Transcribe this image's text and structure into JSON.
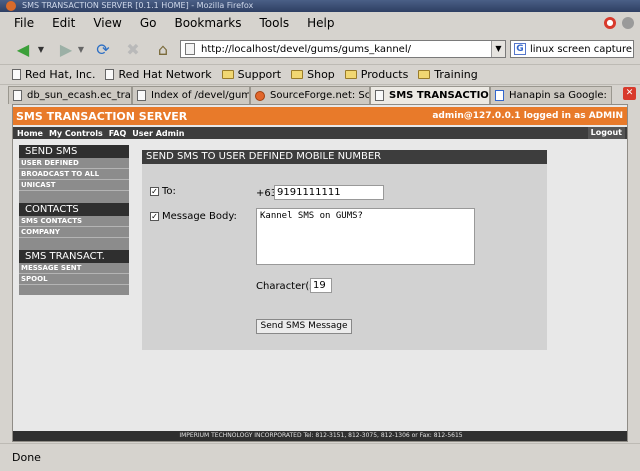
{
  "window": {
    "title": "SMS TRANSACTION SERVER [0.1.1 HOME] - Mozilla Firefox"
  },
  "menu": [
    "File",
    "Edit",
    "View",
    "Go",
    "Bookmarks",
    "Tools",
    "Help"
  ],
  "toolbar": {
    "url": "http://localhost/devel/gums/gums_kannel/",
    "search_value": "linux screen capture"
  },
  "bookmarks": [
    {
      "label": "Red Hat, Inc.",
      "icon": "page-icon"
    },
    {
      "label": "Red Hat Network",
      "icon": "page-icon"
    },
    {
      "label": "Support",
      "icon": "folder-icon"
    },
    {
      "label": "Shop",
      "icon": "folder-icon"
    },
    {
      "label": "Products",
      "icon": "folder-icon"
    },
    {
      "label": "Training",
      "icon": "folder-icon"
    }
  ],
  "tabs": [
    {
      "label": "db_sun_ecash.ec_tra..."
    },
    {
      "label": "Index of /devel/gums"
    },
    {
      "label": "SourceForge.net: Scr..."
    },
    {
      "label": "SMS TRANSACTIO..."
    },
    {
      "label": "Hanapin sa Google: li..."
    }
  ],
  "app": {
    "title": "SMS TRANSACTION SERVER",
    "user": "admin@127.0.0.1 logged in as ADMIN",
    "nav": [
      "Home",
      "My Controls",
      "FAQ",
      "User Admin"
    ],
    "logout": "Logout",
    "sidebar": {
      "send_sms": {
        "title": "SEND SMS",
        "items": [
          "USER DEFINED",
          "BROADCAST TO ALL",
          "UNICAST"
        ]
      },
      "contacts": {
        "title": "CONTACTS",
        "items": [
          "SMS CONTACTS",
          "COMPANY"
        ]
      },
      "transact": {
        "title": "SMS TRANSACT.",
        "items": [
          "MESSAGE SENT",
          "SPOOL"
        ]
      }
    },
    "form": {
      "heading": "SEND SMS TO USER DEFINED MOBILE NUMBER",
      "to_label": "To:",
      "prefix": "+63",
      "phone": "9191111111",
      "body_label": "Message Body:",
      "body": "Kannel SMS on GUMS?",
      "chars_label": "Character(s):",
      "chars": "19",
      "send_label": "Send SMS Message"
    },
    "footer": "IMPERIUM TECHNOLOGY INCORPORATED Tel: 812-3151, 812-3075, 812-1306 or Fax: 812-5615"
  },
  "status": "Done"
}
